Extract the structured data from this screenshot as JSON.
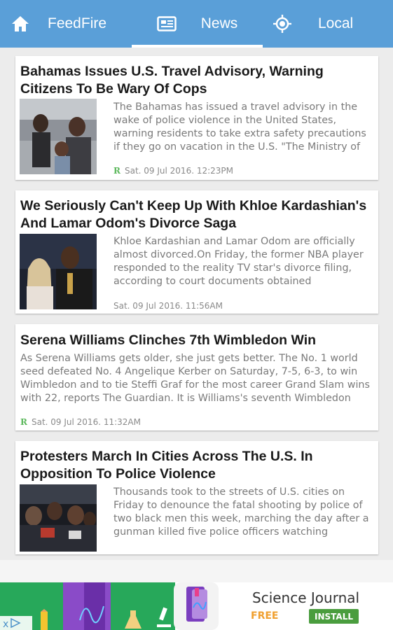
{
  "nav": {
    "home_label": "FeedFire",
    "news_label": "News",
    "local_label": "Local"
  },
  "articles": [
    {
      "title": "Bahamas Issues U.S. Travel Advisory, Warning Citizens To Be Wary Of Cops",
      "excerpt": "The Bahamas has issued a travel advisory in the wake of police violence in the United States, warning residents to take extra safety precautions if they go on vacation in the U.S. \"The Ministry of",
      "date": "Sat. 09 Jul 2016. 12:23PM",
      "source_icon": "rss-icon"
    },
    {
      "title": "We Seriously Can't Keep Up With Khloe Kardashian's And Lamar Odom's Divorce Saga",
      "excerpt": "Khloe Kardashian and Lamar Odom are officially almost divorced.On Friday, the former NBA player responded to the reality TV star's divorce filing, according to court documents obtained",
      "date": "Sat. 09 Jul 2016. 11:56AM"
    },
    {
      "title": "Serena Williams Clinches 7th Wimbledon Win",
      "excerpt": "As Serena Williams gets older, she just gets better. The No. 1 world seed defeated No. 4 Angelique Kerber on Saturday, 7-5, 6-3, to win Wimbledon and to tie Steffi Graf for the most career Grand Slam wins with 22, reports The Guardian. It is Williams's seventh Wimbledon",
      "date": "Sat. 09 Jul 2016. 11:32AM",
      "source_icon": "rss-icon"
    },
    {
      "title": "Protesters March In Cities Across The U.S. In Opposition To Police Violence",
      "excerpt": "Thousands took to the streets of U.S. cities on Friday to denounce the fatal shooting by police of two black men this week, marching the day after a gunman killed five police officers watching"
    }
  ],
  "ad": {
    "title": "Science Journal",
    "price": "FREE",
    "install_label": "INSTALL"
  },
  "colors": {
    "topbar": "#5a9fd8",
    "rss": "#5cb85c",
    "install": "#4a9d3e",
    "free": "#f0a030"
  }
}
